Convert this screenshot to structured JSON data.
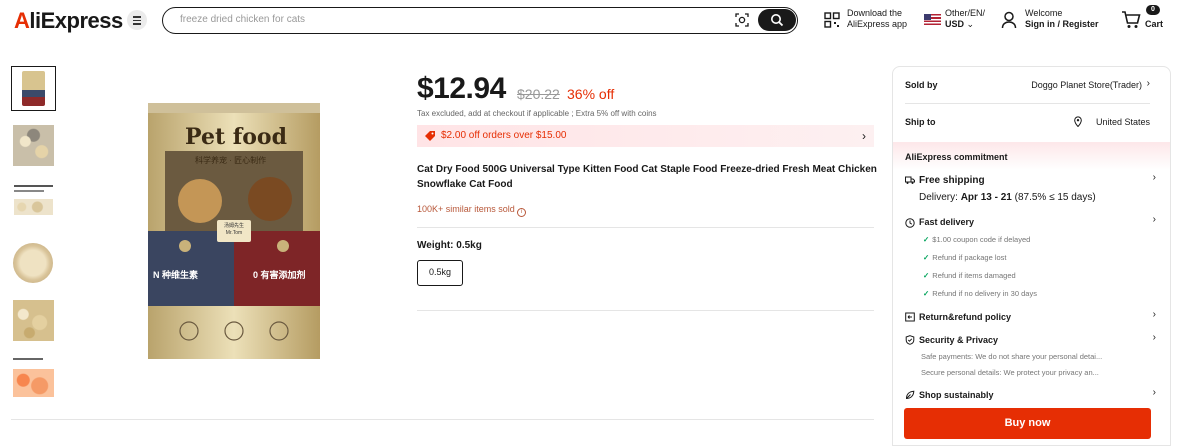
{
  "header": {
    "logo": "AliExpress",
    "search_placeholder": "freeze dried chicken for cats",
    "download_line1": "Download the",
    "download_line2": "AliExpress app",
    "locale_line1": "Other/EN/",
    "locale_line2": "USD",
    "welcome": "Welcome",
    "signin": "Sign in / Register",
    "cart_count": "0",
    "cart_label": "Cart"
  },
  "gallery": {
    "thumbnails": [
      "package",
      "kibble-closeup",
      "text-chart",
      "bowl",
      "kibble-pile",
      "salmon"
    ],
    "selected_index": 0,
    "main_image_text": {
      "brand": "Pet food",
      "subtitle": "科学养宠 · 匠心制作",
      "badge_line1": "汤姆先生",
      "badge_line2": "Mr.Tom",
      "left_panel_text": "N 种维生素",
      "right_panel_text": "0 有害添加剂"
    }
  },
  "product": {
    "price": "$12.94",
    "original_price": "$20.22",
    "discount": "36% off",
    "tax_note": "Tax excluded, add at checkout if applicable ; Extra 5% off with coins",
    "coupon": "$2.00 off orders over $15.00",
    "title": "Cat Dry Food 500G Universal Type Kitten Food Cat Staple Food Freeze-dried Fresh Meat Chicken Snowflake Cat Food",
    "sold": "100K+ similar items sold",
    "weight_label": "Weight: 0.5kg",
    "weight_option": "0.5kg"
  },
  "panel": {
    "sold_by_label": "Sold by",
    "store": "Doggo Planet Store(Trader)",
    "ship_to_label": "Ship to",
    "ship_to": "United States",
    "commitment": "AliExpress commitment",
    "free_shipping": "Free shipping",
    "delivery_label": "Delivery:",
    "delivery_dates": "Apr 13 - 21",
    "delivery_rate": "(87.5% ≤ 15 days)",
    "fast_delivery": "Fast delivery",
    "fast_items": [
      "$1.00 coupon code if delayed",
      "Refund if package lost",
      "Refund if items damaged",
      "Refund if no delivery in 30 days"
    ],
    "return_policy": "Return&refund policy",
    "security": "Security & Privacy",
    "security_lines": [
      "Safe payments: We do not share your personal detai...",
      "Secure personal details: We protect your privacy an..."
    ],
    "sustainably": "Shop sustainably",
    "buy_now": "Buy now"
  },
  "colors": {
    "brand_red": "#e62e04",
    "success_green": "#00a35a"
  }
}
